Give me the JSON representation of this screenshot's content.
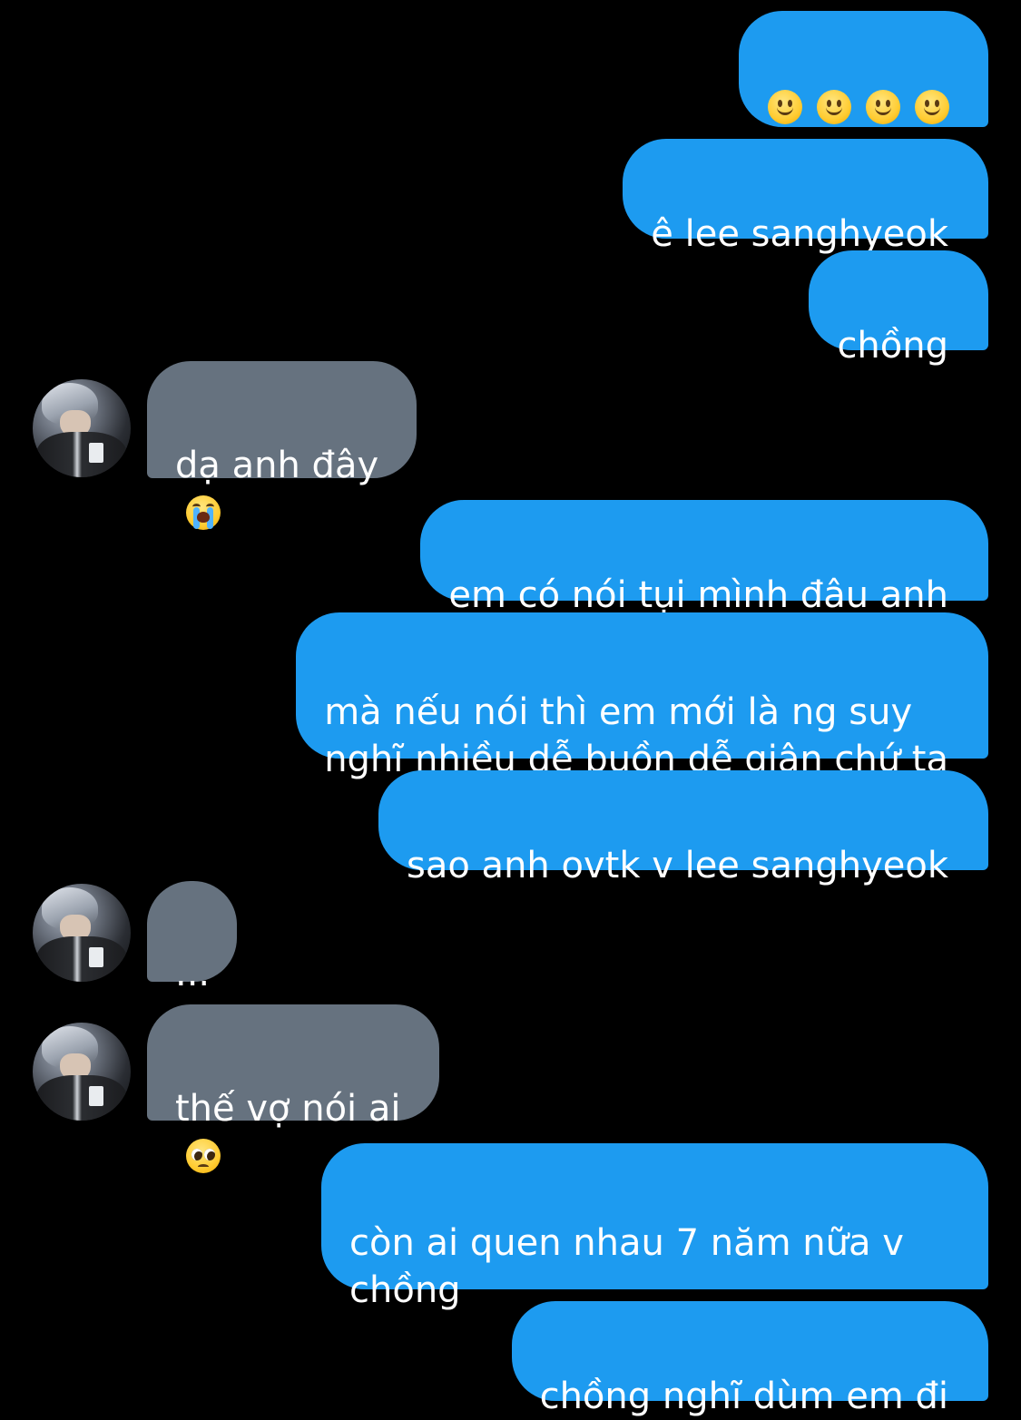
{
  "conversation": {
    "messages": [
      {
        "id": "m1",
        "side": "sent",
        "text": "",
        "emojis": [
          "slightly-smiling-face",
          "slightly-smiling-face",
          "slightly-smiling-face",
          "slightly-smiling-face"
        ]
      },
      {
        "id": "m2",
        "side": "sent",
        "text": "ê lee sanghyeok"
      },
      {
        "id": "m3",
        "side": "sent",
        "text": "chồng"
      },
      {
        "id": "m4",
        "side": "received",
        "text": "dạ anh đây",
        "emoji": "loudly-crying-face"
      },
      {
        "id": "m5",
        "side": "sent",
        "text": "em có nói tụi mình đâu anh"
      },
      {
        "id": "m6",
        "side": "sent",
        "text": "mà nếu nói thì em mới là ng suy\nnghĩ nhiều dễ buồn dễ giận chứ ta"
      },
      {
        "id": "m7",
        "side": "sent",
        "text": "sao anh ovtk v lee sanghyeok"
      },
      {
        "id": "m8",
        "side": "received",
        "text": "..."
      },
      {
        "id": "m9",
        "side": "received",
        "text": "thế vợ nói ai",
        "emoji": "pleading-face"
      },
      {
        "id": "m10",
        "side": "sent",
        "text": "còn ai quen nhau 7 năm nữa v\nchồng"
      },
      {
        "id": "m11",
        "side": "sent",
        "text": "chồng nghĩ dùm em đi"
      }
    ]
  },
  "colors": {
    "background": "#000000",
    "sent_bubble": "#1d9bf0",
    "received_bubble": "#66727f",
    "text": "#ffffff"
  }
}
